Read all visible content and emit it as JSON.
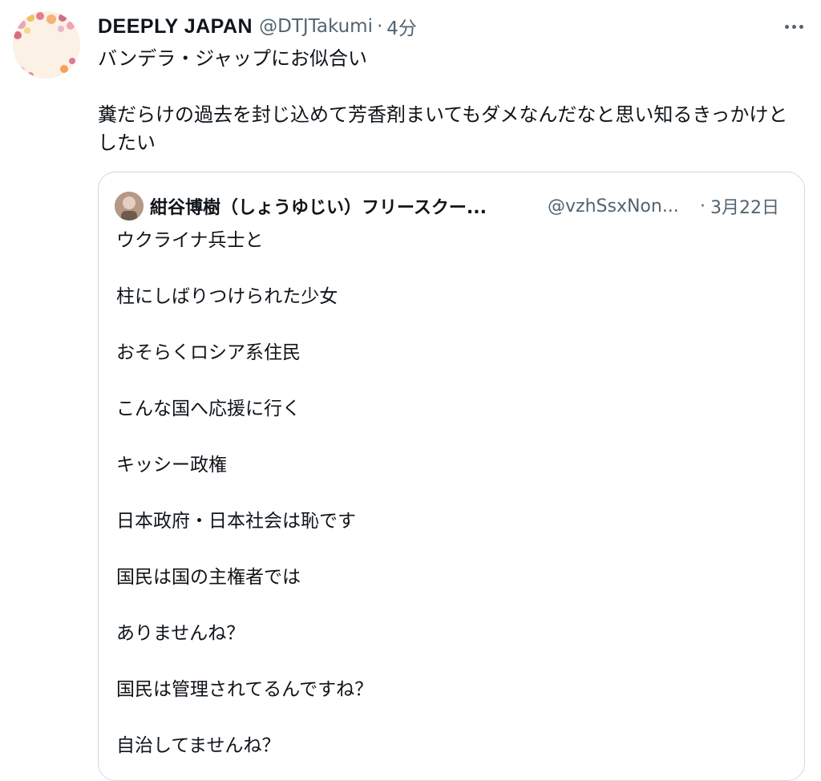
{
  "tweet": {
    "display_name": "DEEPLY JAPAN",
    "handle": "@DTJTakumi",
    "separator": "·",
    "time": "4分",
    "avatar_icon": "floral-avatar-icon",
    "more_icon": "more-options-icon",
    "text": "バンデラ・ジャップにお似合い\n\n糞だらけの過去を封じ込めて芳香剤まいてもダメなんだなと思い知るきっかけと\nしたい"
  },
  "quoted_tweet": {
    "display_name": "紺谷博樹（しょうゆじい）フリースクー...",
    "handle": "@vzhSsxNon...",
    "separator": "·",
    "time": "3月22日",
    "avatar_icon": "user-photo-icon",
    "lines": [
      "ウクライナ兵士と",
      "柱にしばりつけられた少女",
      "おそらくロシア系住民",
      "こんな国へ応援に行く",
      "キッシー政権",
      "日本政府・日本社会は恥です",
      "国民は国の主権者では",
      "ありませんね？",
      "国民は管理されてるんですね？",
      "自治してませんね？"
    ]
  },
  "colors": {
    "text": "#0f1419",
    "secondary": "#536471",
    "border": "#cfd9de"
  }
}
